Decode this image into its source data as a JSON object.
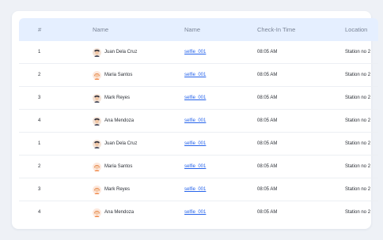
{
  "table": {
    "headers": {
      "num": "#",
      "name": "Name",
      "file": "Name",
      "time": "Check-In Time",
      "location": "Location"
    },
    "rows": [
      {
        "num": "1",
        "name": "Juan Dela Cruz",
        "avatar": "male-dark-hair-icon",
        "file": "selfie_001",
        "time": "08:05 AM",
        "location": "Station no 2"
      },
      {
        "num": "2",
        "name": "Maria Santos",
        "avatar": "female-avatar-icon",
        "file": "selfie_001",
        "time": "08:05 AM",
        "location": "Station no 2"
      },
      {
        "num": "3",
        "name": "Mark Reyes",
        "avatar": "male-dark-hair-icon",
        "file": "selfie_001",
        "time": "08:05 AM",
        "location": "Station no 2"
      },
      {
        "num": "4",
        "name": "Ana Mendoza",
        "avatar": "male-dark-hair-icon",
        "file": "selfie_001",
        "time": "08:05 AM",
        "location": "Station no 2"
      },
      {
        "num": "1",
        "name": "Juan Dela Cruz",
        "avatar": "male-dark-hair-icon",
        "file": "selfie_001",
        "time": "08:05 AM",
        "location": "Station no 2"
      },
      {
        "num": "2",
        "name": "Maria Santos",
        "avatar": "female-avatar-icon",
        "file": "selfie_001",
        "time": "08:05 AM",
        "location": "Station no 2"
      },
      {
        "num": "3",
        "name": "Mark Reyes",
        "avatar": "female-avatar-icon",
        "file": "selfie_001",
        "time": "08:05 AM",
        "location": "Station no 2"
      },
      {
        "num": "4",
        "name": "Ana Mendoza",
        "avatar": "female-avatar-icon",
        "file": "selfie_001",
        "time": "08:05 AM",
        "location": "Station no 2"
      }
    ]
  },
  "colors": {
    "header_bg": "#e5efff",
    "link": "#2563eb",
    "page_bg": "#eef1f6"
  }
}
